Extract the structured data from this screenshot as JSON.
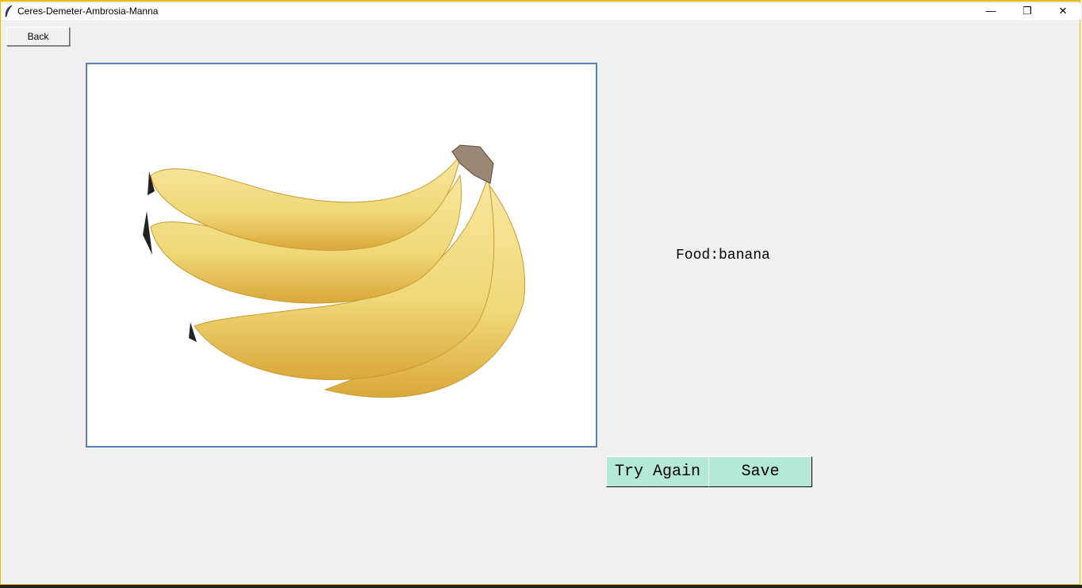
{
  "window": {
    "title": "Ceres-Demeter-Ambrosia-Manna",
    "minimize": "—",
    "restore": "❐",
    "close": "✕"
  },
  "back_label": "Back",
  "image": {
    "subject": "banana-photo"
  },
  "result": {
    "text": "Food:banana"
  },
  "buttons": {
    "try_again": "Try Again",
    "save": "Save"
  },
  "colors": {
    "button_bg": "#b3e9d5",
    "window_bg": "#f0f0f0",
    "image_border": "#5a7fb8"
  }
}
